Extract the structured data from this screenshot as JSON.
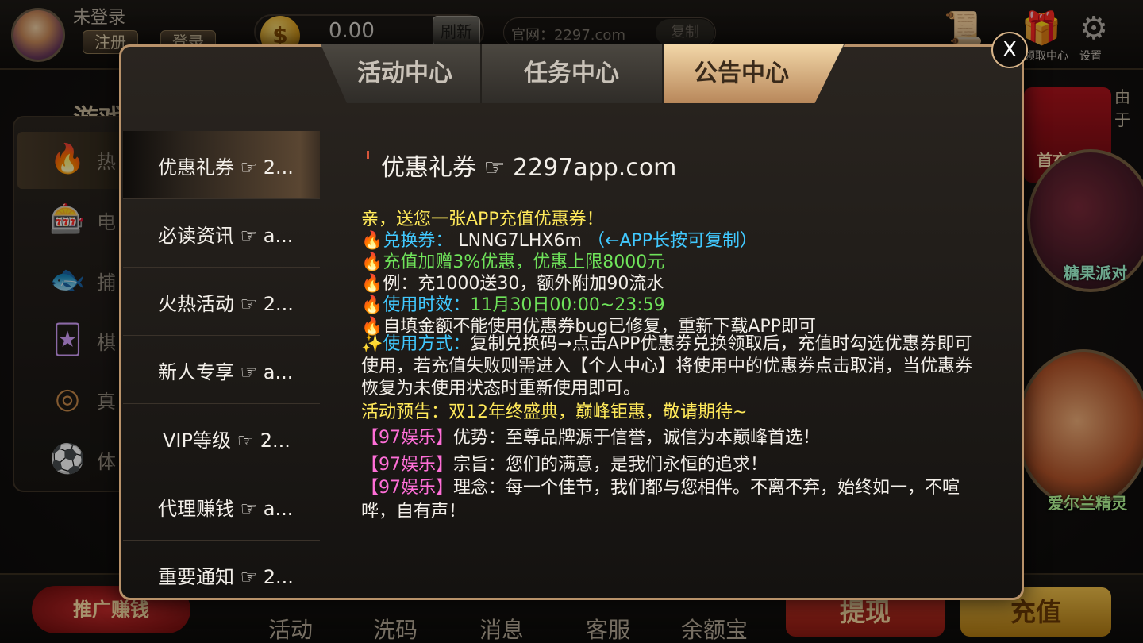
{
  "header": {
    "username": "未登录",
    "register_label": "注册",
    "login_label": "登录",
    "balance": "0.00",
    "refresh_label": "刷新",
    "site_label": "官网：2297.com",
    "copy_label": "复制",
    "gift_label": "领取中心",
    "settings_label": "设置",
    "marquee_text": "由于"
  },
  "games_nav": {
    "title": "游戏",
    "items": [
      {
        "label": "热",
        "icon": "hot-icon"
      },
      {
        "label": "电",
        "icon": "slot-machine-icon"
      },
      {
        "label": "捕",
        "icon": "fish-icon"
      },
      {
        "label": "棋",
        "icon": "cards-icon"
      },
      {
        "label": "真",
        "icon": "roulette-icon"
      },
      {
        "label": "体",
        "icon": "soccer-ball-icon"
      }
    ]
  },
  "promos": {
    "topup_label": "首充送",
    "candy_label": "糖果派对",
    "leprechaun_label": "爱尔兰精灵"
  },
  "bottom": {
    "promo_label": "推广赚钱",
    "items": [
      "活动",
      "洗码",
      "消息",
      "客服",
      "余额宝"
    ],
    "withdraw_label": "提现",
    "deposit_label": "充值"
  },
  "modal": {
    "tabs": [
      "活动中心",
      "任务中心",
      "公告中心"
    ],
    "active_tab": "公告中心",
    "close_label": "X",
    "list": [
      "优惠礼券 ☞ 2...",
      "必读资讯 ☞ a...",
      "火热活动 ☞ 2...",
      "新人专享 ☞ a...",
      "VIP等级 ☞ 2...",
      "代理赚钱 ☞ a...",
      "重要通知 ☞ 2..."
    ],
    "content": {
      "title": "优惠礼券 ☞ 2297app.com",
      "greeting": "亲，送您一张APP充值优惠券！",
      "coupon_label": "兑换券：",
      "coupon_code": "LNNG7LHX6m",
      "coupon_hint": "（←APP长按可复制）",
      "bonus": "充值加赠3%优惠，优惠上限8000元",
      "example": "例：充1000送30，额外附加90流水",
      "valid_label": "使用时效：",
      "valid_time": "11月30日00:00~23:59",
      "bugfix": "自填金额不能使用优惠券bug已修复，重新下载APP即可",
      "usage_label": "使用方式：",
      "usage_text": "复制兑换码→点击APP优惠券兑换领取后，充值时勾选优惠券即可使用，若充值失败则需进入【个人中心】将使用中的优惠券点击取消，当优惠券恢复为未使用状态时重新使用即可。",
      "preview": "活动预告：双12年终盛典，巅峰钜惠，敬请期待~",
      "brand_tag": "【97娱乐】",
      "brand_1": "优势：至尊品牌源于信誉，诚信为本巅峰首选！",
      "brand_2": "宗旨：您们的满意，是我们永恒的追求！",
      "brand_3": "理念：每一个佳节，我们都与您相伴。不离不弃，始终如一，不喧哗，自有声！"
    }
  }
}
